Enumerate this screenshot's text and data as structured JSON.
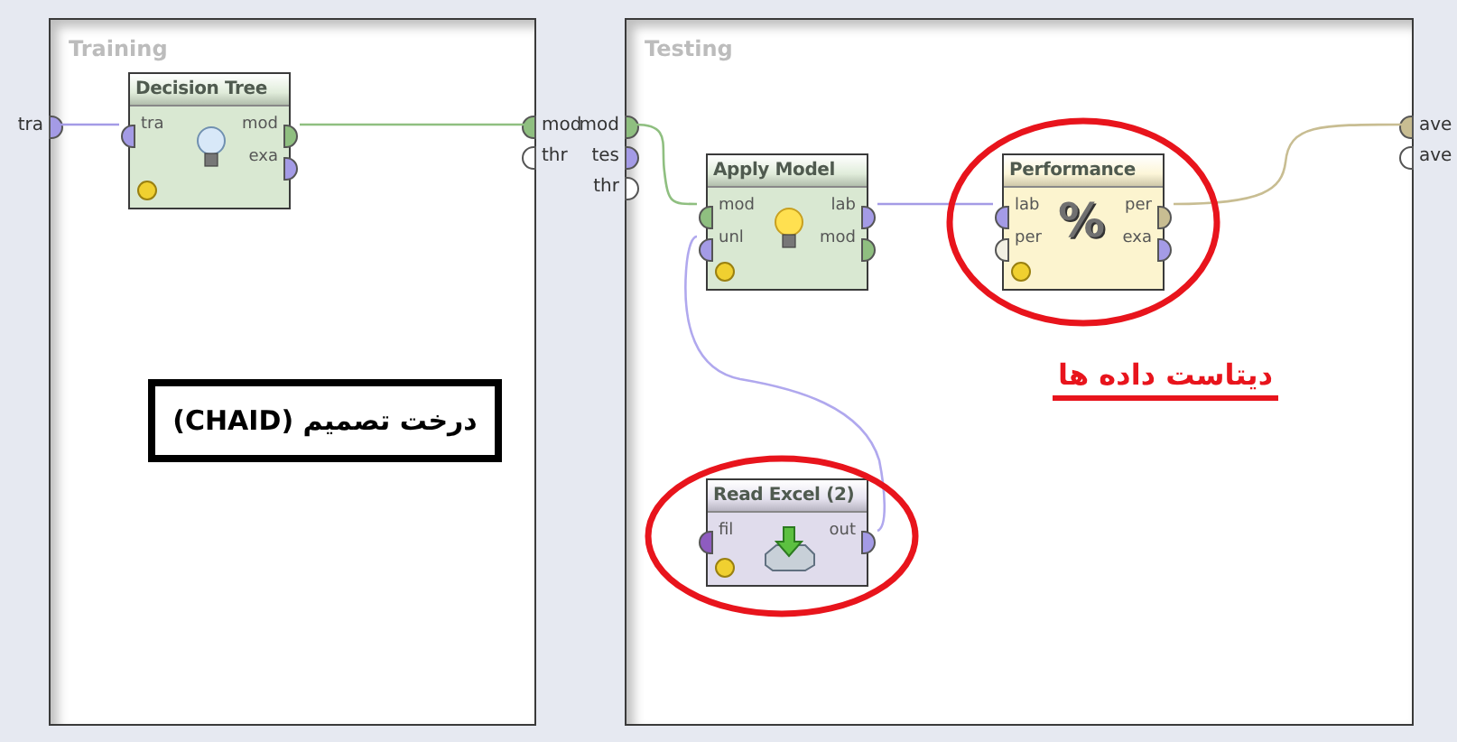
{
  "panels": [
    {
      "title": "Training",
      "inputs": [
        {
          "label": "tra",
          "color": "#a49be6"
        }
      ],
      "outputs": [
        {
          "label": "mod",
          "color": "#8fbf80"
        },
        {
          "label": "thr",
          "color": "#ffffff"
        }
      ]
    },
    {
      "title": "Testing",
      "inputs": [
        {
          "label": "mod",
          "color": "#8fbf80"
        },
        {
          "label": "tes",
          "color": "#a49be6"
        },
        {
          "label": "thr",
          "color": "#ffffff"
        }
      ],
      "outputs": [
        {
          "label": "ave",
          "color": "#c8bd92"
        },
        {
          "label": "ave",
          "color": "#ffffff"
        }
      ]
    }
  ],
  "operators": [
    {
      "title": "Decision Tree",
      "kind": "bulb",
      "color": "#d9e8d2",
      "inputs": [
        {
          "label": "tra",
          "color": "#a49be6"
        }
      ],
      "outputs": [
        {
          "label": "mod",
          "color": "#8fbf80"
        },
        {
          "label": "exa",
          "color": "#a49be6"
        }
      ]
    },
    {
      "title": "Apply Model",
      "kind": "bulb",
      "color": "#d9e8d2",
      "inputs": [
        {
          "label": "mod",
          "color": "#8fbf80"
        },
        {
          "label": "unl",
          "color": "#a49be6"
        }
      ],
      "outputs": [
        {
          "label": "lab",
          "color": "#a49be6"
        },
        {
          "label": "mod",
          "color": "#8fbf80"
        }
      ]
    },
    {
      "title": "Performance",
      "kind": "symbol",
      "symbol": "%",
      "color": "#fcf4cf",
      "inputs": [
        {
          "label": "lab",
          "color": "#a49be6"
        },
        {
          "label": "per",
          "color": "#f2f0e4"
        }
      ],
      "outputs": [
        {
          "label": "per",
          "color": "#c8bd92"
        },
        {
          "label": "exa",
          "color": "#a49be6"
        }
      ]
    },
    {
      "title": "Read Excel (2)",
      "kind": "import",
      "color": "#e0dcec",
      "inputs": [
        {
          "label": "fil",
          "color": "#8e5cc0"
        }
      ],
      "outputs": [
        {
          "label": "out",
          "color": "#a49be6"
        }
      ]
    }
  ],
  "annotations": [
    {
      "kind": "boxed",
      "text": "درخت تصمیم (CHAID)"
    },
    {
      "kind": "underlined",
      "text": "دیتاست داده ها"
    }
  ]
}
